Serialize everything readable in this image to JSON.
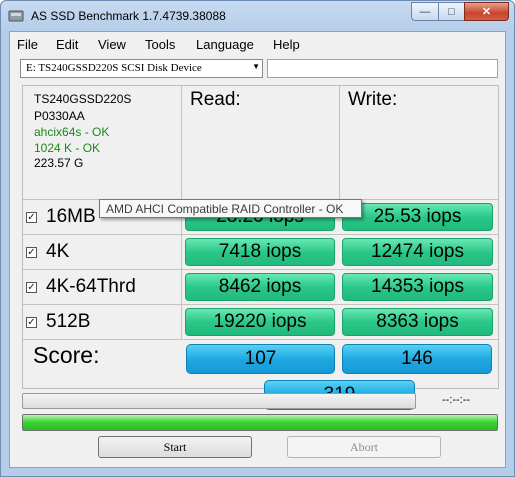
{
  "window": {
    "title": "AS SSD Benchmark 1.7.4739.38088"
  },
  "menu": [
    "File",
    "Edit",
    "View",
    "Tools",
    "Language",
    "Help"
  ],
  "drive": {
    "selected": "E:  TS240GSSD220S SCSI Disk Device",
    "path_value": ""
  },
  "info": {
    "model": "TS240GSSD220S",
    "firmware": "P0330AA",
    "driver": "ahcix64s - OK",
    "alignment": "1024 K - OK",
    "capacity": "223.57 G"
  },
  "tooltip": "AMD AHCI Compatible RAID Controller - OK",
  "columns": {
    "read": "Read:",
    "write": "Write:"
  },
  "rows": [
    {
      "label": "16MB",
      "checked": true,
      "read": "28.20 iops",
      "write": "25.53 iops"
    },
    {
      "label": "4K",
      "checked": true,
      "read": "7418 iops",
      "write": "12474 iops"
    },
    {
      "label": "4K-64Thrd",
      "checked": true,
      "read": "8462 iops",
      "write": "14353 iops"
    },
    {
      "label": "512B",
      "checked": true,
      "read": "19220 iops",
      "write": "8363 iops"
    }
  ],
  "score": {
    "label": "Score:",
    "read": "107",
    "write": "146",
    "total": "319"
  },
  "progress": {
    "time": "--:--:--",
    "test_fraction": 0,
    "total_fraction": 1.0
  },
  "buttons": {
    "start": "Start",
    "abort": "Abort"
  },
  "icons": {
    "app": "disk-icon",
    "check": "checkmark-icon"
  },
  "colors": {
    "result": "#2ac88a",
    "score": "#1fa8e2",
    "progress": "#37d12f",
    "driver_ok": "#1a8a1a"
  }
}
